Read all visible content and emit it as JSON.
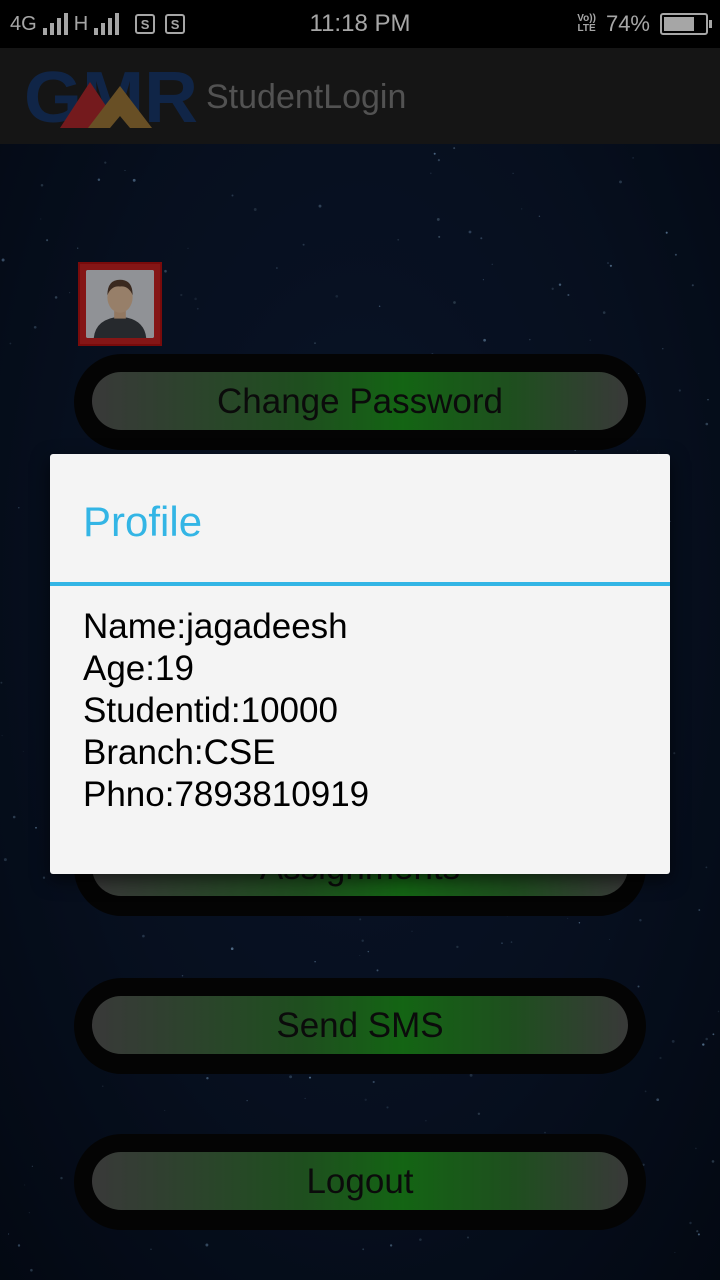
{
  "status_bar": {
    "network1": "4G",
    "network2": "H",
    "sim1_icon": "S",
    "sim2_icon": "S",
    "time": "11:18 PM",
    "volte_top": "Vo))",
    "volte_bottom": "LTE",
    "battery_text": "74%",
    "battery_level": 0.74
  },
  "app_bar": {
    "logo_text": "GMR",
    "title": "StudentLogin"
  },
  "buttons": {
    "change_password": "Change Password",
    "assignments": "Assignments",
    "send_sms": "Send SMS",
    "logout": "Logout"
  },
  "dialog": {
    "title": "Profile",
    "lines": [
      "Name:jagadeesh",
      "Age:19",
      "Studentid:10000",
      "Branch:CSE",
      "Phno:7893810919"
    ]
  },
  "colors": {
    "accent": "#33b5e5",
    "button_green": "#1f9b1f",
    "logo_blue": "#1a3a6e",
    "logo_red": "#b3282d",
    "logo_gold": "#a07a3a"
  },
  "icons": [
    "signal-icon",
    "sim-icon",
    "volte-icon",
    "battery-icon",
    "avatar-icon"
  ]
}
